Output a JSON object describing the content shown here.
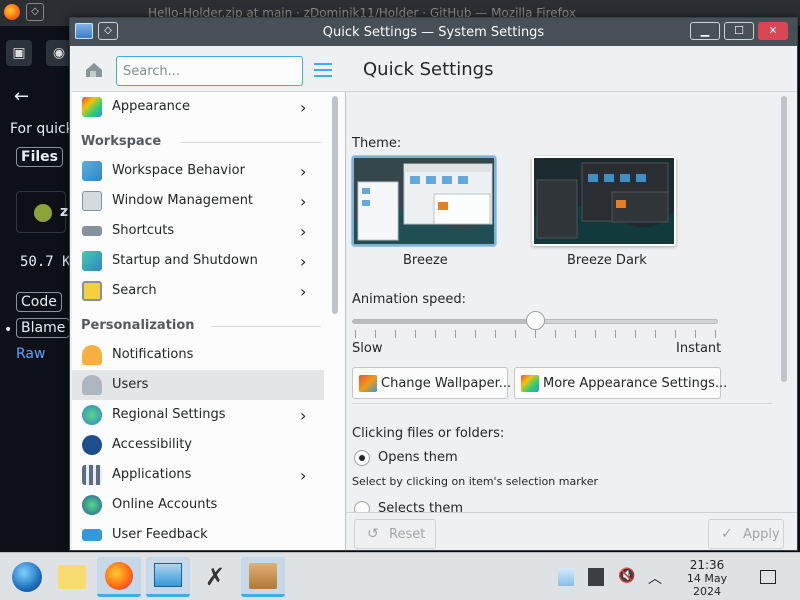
{
  "background": {
    "titlebar": "Hello-Holder.zip at main · zDominik11/Holder · GitHub — Mozilla Firefox",
    "texts": [
      "For quick",
      "Files",
      "zD",
      "50.7 K",
      "Code",
      "Blame",
      "Raw"
    ]
  },
  "window": {
    "title": "Quick Settings — System Settings",
    "buttons": {
      "minimize": "▁",
      "maximize": "☐",
      "close": "✕",
      "pin": "◇"
    }
  },
  "sidebar": {
    "search_placeholder": "Search...",
    "sections": {
      "workspace": "Workspace",
      "personalization": "Personalization"
    },
    "items": [
      {
        "label": "Appearance",
        "icon": "appearance-icon",
        "chevron": true
      },
      {
        "label": "Workspace Behavior",
        "icon": "workspace-behavior-icon",
        "chevron": true
      },
      {
        "label": "Window Management",
        "icon": "window-management-icon",
        "chevron": true
      },
      {
        "label": "Shortcuts",
        "icon": "shortcuts-icon",
        "chevron": true
      },
      {
        "label": "Startup and Shutdown",
        "icon": "startup-icon",
        "chevron": true
      },
      {
        "label": "Search",
        "icon": "search-icon",
        "chevron": true
      },
      {
        "label": "Notifications",
        "icon": "notifications-icon",
        "chevron": false
      },
      {
        "label": "Users",
        "icon": "users-icon",
        "chevron": false
      },
      {
        "label": "Regional Settings",
        "icon": "regional-icon",
        "chevron": true
      },
      {
        "label": "Accessibility",
        "icon": "accessibility-icon",
        "chevron": false
      },
      {
        "label": "Applications",
        "icon": "applications-icon",
        "chevron": true
      },
      {
        "label": "Online Accounts",
        "icon": "online-accounts-icon",
        "chevron": false
      },
      {
        "label": "User Feedback",
        "icon": "user-feedback-icon",
        "chevron": false
      }
    ],
    "chevron_glyph": "›"
  },
  "content": {
    "title": "Quick Settings",
    "theme_label": "Theme:",
    "themes": [
      {
        "label": "Breeze",
        "selected": true
      },
      {
        "label": "Breeze Dark",
        "selected": false
      }
    ],
    "animation_label": "Animation speed:",
    "slider": {
      "min_label": "Slow",
      "max_label": "Instant",
      "value": 0.5
    },
    "change_wallpaper": "Change Wallpaper...",
    "more_appearance": "More Appearance Settings...",
    "clicking_label": "Clicking files or folders:",
    "opens_them": "Opens them",
    "select_note": "Select by clicking on item's selection marker",
    "selects_them": "Selects them",
    "reset": "Reset",
    "apply": "Apply"
  },
  "taskbar": {
    "time": "21:36",
    "date": "14 May 2024"
  },
  "colors": {
    "accent": "#3daee9",
    "titlebar": "#475057",
    "close": "#da4453"
  }
}
